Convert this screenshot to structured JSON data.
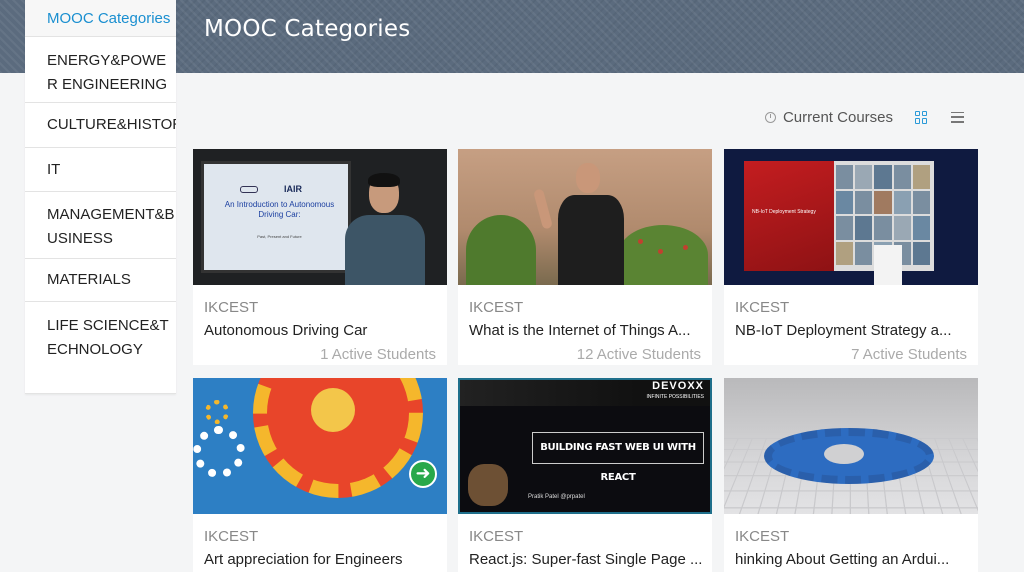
{
  "header": {
    "title": "MOOC Categories"
  },
  "sidebar": {
    "items": [
      {
        "label": "MOOC Categories",
        "active": true
      },
      {
        "label": "ENERGY&POWER ENGINEERING"
      },
      {
        "label": "CULTURE&HISTORY"
      },
      {
        "label": "IT"
      },
      {
        "label": "MANAGEMENT&BUSINESS"
      },
      {
        "label": "MATERIALS"
      },
      {
        "label": "LIFE SCIENCE&TECHNOLOGY"
      }
    ]
  },
  "toolbar": {
    "filter_label": "Current Courses",
    "filter_icon": "clock-icon",
    "grid_view_icon": "grid-view-icon",
    "list_view_icon": "list-view-icon",
    "accent_color": "#2a9ad8"
  },
  "courses": [
    {
      "org": "IKCEST",
      "title": "Autonomous Driving Car",
      "students": "1 Active Students",
      "thumb_text": {
        "logo": "IAIR",
        "heading": "An Introduction to Autonomous Driving Car:",
        "subheading": "Past, Present and Future"
      }
    },
    {
      "org": "IKCEST",
      "title": "What is the Internet of Things A...",
      "students": "12 Active Students"
    },
    {
      "org": "IKCEST",
      "title": "NB-IoT Deployment Strategy a...",
      "students": "7 Active Students",
      "thumb_text": {
        "slide_title": "NB-IoT Deployment Strategy"
      }
    },
    {
      "org": "IKCEST",
      "title": "Art appreciation for Engineers"
    },
    {
      "org": "IKCEST",
      "title": "React.js: Super-fast Single Page ...",
      "thumb_text": {
        "brand": "DEVOXX",
        "tagline": "INFINITE POSSIBILITIES",
        "headline": "BUILDING FAST WEB UI WITH REACT",
        "caption": "Pratik Patel @prpatel"
      }
    },
    {
      "org": "IKCEST",
      "title": "hinking About Getting an Ardui..."
    }
  ]
}
